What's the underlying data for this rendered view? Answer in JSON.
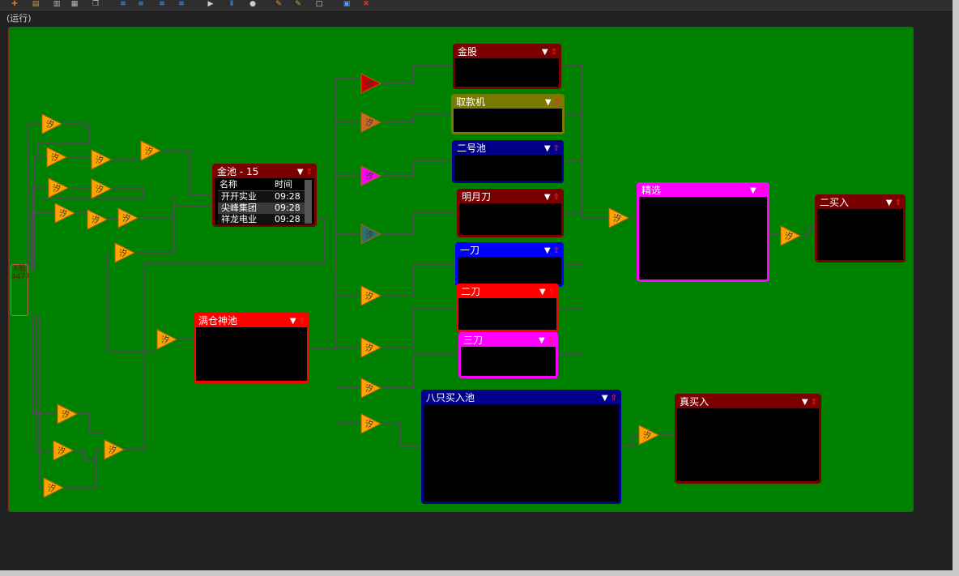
{
  "status": "(运行)",
  "toolbar": {
    "icons": [
      "new-icon",
      "open-icon",
      "save-icon",
      "print-icon",
      "copy-icon",
      "align-left-icon",
      "align-center-icon",
      "align-right-icon",
      "align-justify-icon",
      "play-icon",
      "pause-icon",
      "stop-icon",
      "edit-icon",
      "edit2-icon",
      "blank-icon",
      "window-icon",
      "close-icon"
    ]
  },
  "side_label": "A股 4477",
  "node_symbol": "汐",
  "panels": {
    "jingu": "金股",
    "qukuanji": "取款机",
    "erhaochi": "二号池",
    "mingyuedao": "明月刀",
    "yidao": "一刀",
    "erdao": "二刀",
    "sandao": "三刀",
    "bazhi": "八只买入池",
    "mancang": "满仓神池",
    "jingxuan": "精选",
    "ermairu": "二买入",
    "zhenmairu": "真买入"
  },
  "jinchi": {
    "title": "金池 - 15",
    "col_name": "名称",
    "col_time": "时间",
    "rows": [
      {
        "name": "开开实业",
        "time": "09:28"
      },
      {
        "name": "尖峰集团",
        "time": "09:28"
      },
      {
        "name": "祥龙电业",
        "time": "09:28"
      }
    ]
  },
  "colors": {
    "canvas": "#008000",
    "node_orange": "#ffa500",
    "wire": "#8a2a8a",
    "maroon": "#7a0000",
    "olive": "#7a7a00",
    "navy": "#00008b",
    "blue": "#0000ff",
    "red": "#ff0000",
    "magenta": "#ff00ff"
  }
}
